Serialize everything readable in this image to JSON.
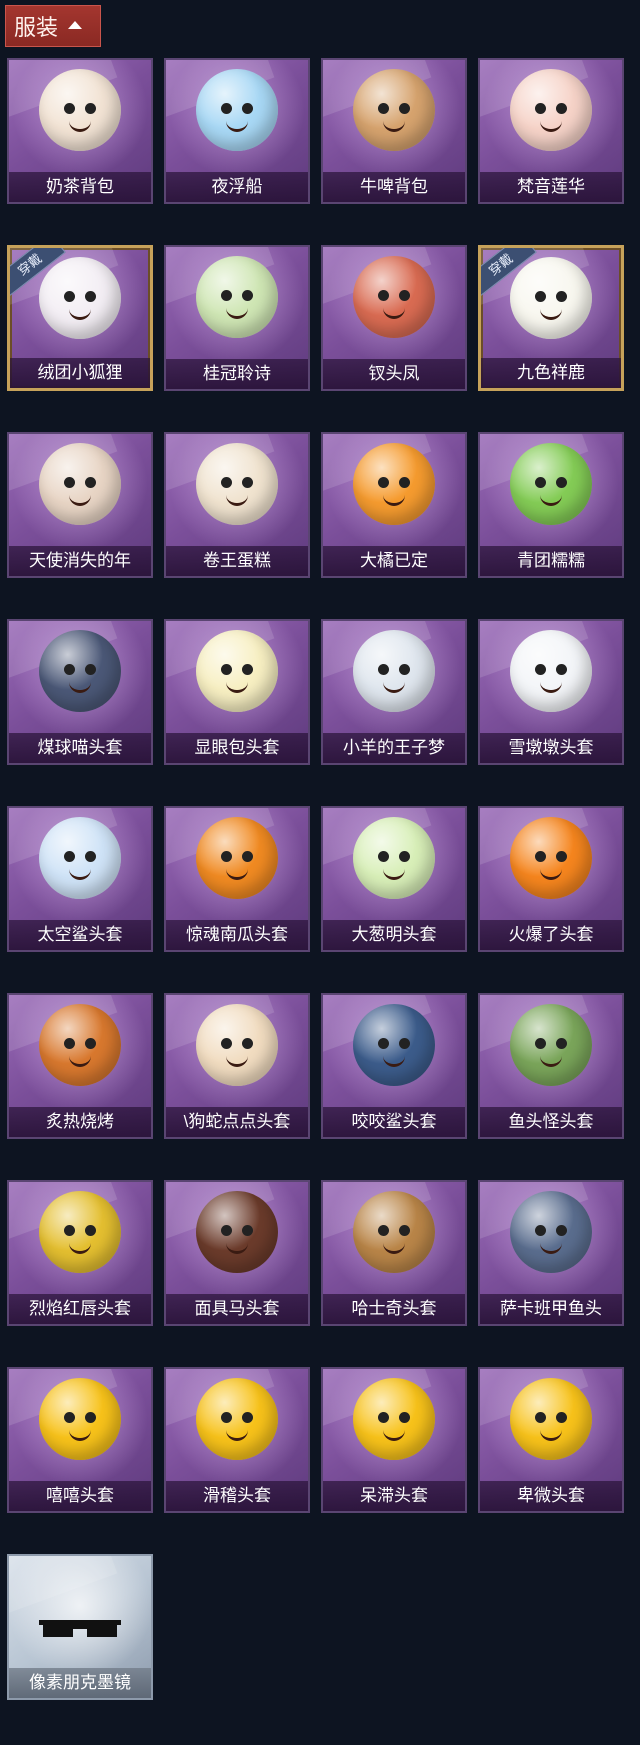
{
  "header": {
    "title": "服装"
  },
  "items": [
    {
      "name": "奶茶背包",
      "icon": "milk-tea-backpack-icon",
      "color": "#f2e3d4",
      "shape": "round"
    },
    {
      "name": "夜浮船",
      "icon": "jellyfish-icon",
      "color": "#a8d8f5",
      "shape": "round"
    },
    {
      "name": "牛啤背包",
      "icon": "cow-beer-backpack-icon",
      "color": "#d6a36e",
      "shape": "round"
    },
    {
      "name": "梵音莲华",
      "icon": "lotus-girl-icon",
      "color": "#f6d3c8",
      "shape": "round"
    },
    {
      "name": "绒团小狐狸",
      "icon": "white-fox-icon",
      "color": "#f3eef4",
      "shape": "round",
      "badge": "穿戴"
    },
    {
      "name": "桂冠聆诗",
      "icon": "laurel-poet-icon",
      "color": "#cfe6b4",
      "shape": "round"
    },
    {
      "name": "钗头凤",
      "icon": "phoenix-hairpin-icon",
      "color": "#d96b52",
      "shape": "round"
    },
    {
      "name": "九色祥鹿",
      "icon": "auspicious-deer-icon",
      "color": "#f8f7ef",
      "shape": "round",
      "badge": "穿戴"
    },
    {
      "name": "天使消失的年",
      "icon": "angel-girl-icon",
      "color": "#e8d5c5",
      "shape": "round"
    },
    {
      "name": "卷王蛋糕",
      "icon": "roll-cake-icon",
      "color": "#f0e3cf",
      "shape": "round"
    },
    {
      "name": "大橘已定",
      "icon": "orange-slice-icon",
      "color": "#f59b2f",
      "shape": "round"
    },
    {
      "name": "青团糯糯",
      "icon": "green-dumpling-icon",
      "color": "#84cc56",
      "shape": "round"
    },
    {
      "name": "煤球喵头套",
      "icon": "black-cat-head-icon",
      "color": "#4b5877",
      "shape": "round"
    },
    {
      "name": "显眼包头套",
      "icon": "bulb-head-icon",
      "color": "#f7efc2",
      "shape": "round"
    },
    {
      "name": "小羊的王子梦",
      "icon": "sheep-prince-head-icon",
      "color": "#dfe6ee",
      "shape": "round"
    },
    {
      "name": "雪墩墩头套",
      "icon": "snowman-head-icon",
      "color": "#f3f5f8",
      "shape": "round"
    },
    {
      "name": "太空鲨头套",
      "icon": "space-shark-head-icon",
      "color": "#cfe3f7",
      "shape": "round"
    },
    {
      "name": "惊魂南瓜头套",
      "icon": "pumpkin-head-icon",
      "color": "#f08a22",
      "shape": "round"
    },
    {
      "name": "大葱明头套",
      "icon": "scallion-head-icon",
      "color": "#d8efb8",
      "shape": "round"
    },
    {
      "name": "火爆了头套",
      "icon": "fire-head-icon",
      "color": "#f5851e",
      "shape": "round"
    },
    {
      "name": "炙热烧烤",
      "icon": "bbq-meat-icon",
      "color": "#d8782e",
      "shape": "round"
    },
    {
      "name": "\\狗蛇点点头套",
      "icon": "dog-snake-head-icon",
      "color": "#f1dcc0",
      "shape": "round"
    },
    {
      "name": "咬咬鲨头套",
      "icon": "biting-shark-head-icon",
      "color": "#3c5c8b",
      "shape": "round"
    },
    {
      "name": "鱼头怪头套",
      "icon": "fish-monster-head-icon",
      "color": "#7aa55a",
      "shape": "round"
    },
    {
      "name": "烈焰红唇头套",
      "icon": "yellow-mouse-head-icon",
      "color": "#e4bf30",
      "shape": "round"
    },
    {
      "name": "面具马头套",
      "icon": "horse-head-icon",
      "color": "#6b3b2b",
      "shape": "round"
    },
    {
      "name": "哈士奇头套",
      "icon": "husky-head-icon",
      "color": "#b98548",
      "shape": "round"
    },
    {
      "name": "萨卡班甲鱼头",
      "icon": "sacabambaspis-head-icon",
      "color": "#5a6d8e",
      "shape": "round"
    },
    {
      "name": "嘻嘻头套",
      "icon": "grin-emoji-head-icon",
      "color": "#f7c21a",
      "shape": "round"
    },
    {
      "name": "滑稽头套",
      "icon": "funny-emoji-head-icon",
      "color": "#f7c21a",
      "shape": "round"
    },
    {
      "name": "呆滞头套",
      "icon": "dazed-emoji-head-icon",
      "color": "#f7c21a",
      "shape": "round"
    },
    {
      "name": "卑微头套",
      "icon": "humble-emoji-head-icon",
      "color": "#f7c21a",
      "shape": "round"
    },
    {
      "name": "像素朋克墨镜",
      "icon": "pixel-sunglasses-icon",
      "color": "#111111",
      "shape": "glasses",
      "silver": true
    }
  ]
}
